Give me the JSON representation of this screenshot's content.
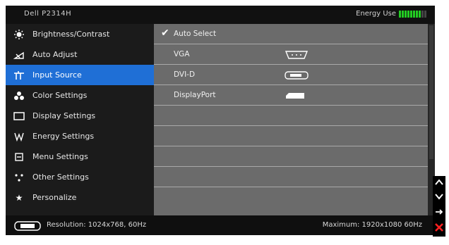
{
  "header": {
    "model": "Dell P2314H",
    "energy_label": "Energy Use",
    "energy_level": 0.75
  },
  "menu": {
    "items": [
      {
        "label": "Brightness/Contrast",
        "icon": "brightness-icon"
      },
      {
        "label": "Auto Adjust",
        "icon": "auto-adjust-icon"
      },
      {
        "label": "Input Source",
        "icon": "input-source-icon",
        "selected": true
      },
      {
        "label": "Color Settings",
        "icon": "color-settings-icon"
      },
      {
        "label": "Display Settings",
        "icon": "display-settings-icon"
      },
      {
        "label": "Energy Settings",
        "icon": "energy-settings-icon"
      },
      {
        "label": "Menu Settings",
        "icon": "menu-settings-icon"
      },
      {
        "label": "Other Settings",
        "icon": "other-settings-icon"
      },
      {
        "label": "Personalize",
        "icon": "star-icon"
      }
    ]
  },
  "input_source": {
    "rows": [
      {
        "label": "Auto Select",
        "checked": true,
        "port": ""
      },
      {
        "label": "VGA",
        "checked": false,
        "port": "vga-port-icon"
      },
      {
        "label": "DVI-D",
        "checked": false,
        "port": "dvi-port-icon"
      },
      {
        "label": "DisplayPort",
        "checked": false,
        "port": "displayport-icon"
      }
    ]
  },
  "footer": {
    "resolution": "Resolution: 1024x768, 60Hz",
    "maximum": "Maximum: 1920x1080 60Hz"
  },
  "controls": {
    "up": "up-arrow-icon",
    "down": "down-arrow-icon",
    "enter": "right-arrow-icon",
    "exit": "exit-icon"
  }
}
